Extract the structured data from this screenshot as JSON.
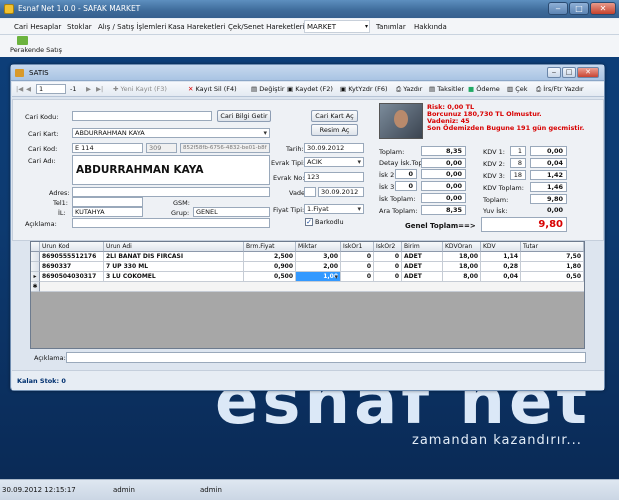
{
  "app_title": "Esnaf Net 1.0.0 - SAFAK MARKET",
  "menu": [
    "Cari Hesaplar",
    "Stoklar",
    "Alış / Satış İşlemleri",
    "Kasa Hareketleri",
    "Çek/Senet Hareketleri",
    "MARKET",
    "Tanımlar",
    "Hakkında"
  ],
  "quick_button": "Perakende Satış",
  "satis": {
    "title": "SATIS",
    "nav_position": "1",
    "nav_total": "-1",
    "toolbar": {
      "yeni": "Yeni Kayıt (F3)",
      "sil": "Kayıt Sil (F4)",
      "degistir": "Değiştir",
      "kaydet": "Kaydet (F2)",
      "kytyzdr": "KytYzdr (F6)",
      "yazdir": "Yazdır",
      "taksitler": "Taksitler",
      "odeme": "Ödeme",
      "cek": "Çek",
      "irs": "İrs/Ftr Yazdır"
    },
    "form": {
      "cari_kodu_label": "Cari Kodu:",
      "cari_bilgi_btn": "Cari Bilgi Getir",
      "cari_kart_label": "Cari Kart:",
      "cari_kart_value": "ABDURRAHMAN KAYA",
      "cari_kod_label": "Cari Kod:",
      "cari_kod_value": "E 114",
      "cari_no": "309",
      "cari_guid": "852f58fb-6756-4832-be01-b8f",
      "cari_adi_label": "Cari Adı:",
      "cari_adi_value": "ABDURRAHMAN KAYA",
      "adres_label": "Adres:",
      "tel_label": "Tel1:",
      "gsm_label": "GSM:",
      "il_label": "İL:",
      "il_value": "KUTAHYA",
      "grup_label": "Grup:",
      "grup_value": "GENEL",
      "aciklama_label": "Açıklama:",
      "cari_kart_ac_btn": "Cari Kart Aç",
      "resim_ac_btn": "Resim Aç",
      "tarih_label": "Tarih:",
      "tarih_value": "30.09.2012",
      "evrak_tipi_label": "Evrak Tipi:",
      "evrak_tipi_value": "ACIK",
      "evrak_no_label": "Evrak No:",
      "evrak_no_value": "123",
      "vade_label": "Vade:",
      "vade_value": "30.09.2012",
      "fiyat_tipi_label": "Fiyat Tipi:",
      "fiyat_tipi_value": "1.Fiyat",
      "barkodlu_label": "Barkodlu"
    },
    "alerts": [
      "Risk: 0,00 TL",
      "Borcunuz 180,730 TL Olmustur.",
      "Vadeniz: 45",
      "Son Ödemizden Bugune 191 gün gecmistir."
    ],
    "totals": {
      "toplam_label": "Toplam:",
      "toplam": "8,35",
      "detay_isk_label": "Detay İsk.Top:",
      "detay_isk": "0,00",
      "isk2_label": "İsk 2:",
      "isk2_pct": "0",
      "isk2": "0,00",
      "isk3_label": "İsk 3:",
      "isk3_pct": "0",
      "isk3": "0,00",
      "isk_toplam_label": "İsk Toplam:",
      "isk_toplam": "0,00",
      "ara_toplam_label": "Ara Toplam:",
      "ara_toplam": "8,35",
      "genel_label": "Genel Toplam==>",
      "genel": "9,80"
    },
    "kdv": {
      "kdv1_label": "KDV 1:",
      "kdv1_rate": "1",
      "kdv1": "0,00",
      "kdv2_label": "KDV 2:",
      "kdv2_rate": "8",
      "kdv2": "0,04",
      "kdv3_label": "KDV 3:",
      "kdv3_rate": "18",
      "kdv3": "1,42",
      "kdv_toplam_label": "KDV Toplam:",
      "kdv_toplam": "1,46",
      "toplam_label": "Toplam:",
      "toplam": "9,80",
      "yuv_isk_label": "Yuv İsk:",
      "yuv_isk": "0,00"
    },
    "grid": {
      "headers": [
        "Urun Kod",
        "Urun Adi",
        "Brm.Fiyat",
        "Miktar",
        "IskOr1",
        "IskOr2",
        "Birim",
        "KDVOran",
        "KDV",
        "Tutar"
      ],
      "rows": [
        [
          "8690555512176",
          "2LI BANAT DIS FIRCASI",
          "2,500",
          "3,00",
          "0",
          "0",
          "ADET",
          "18,00",
          "1,14",
          "7,50"
        ],
        [
          "8690337",
          "7 UP 330 ML",
          "0,900",
          "2,00",
          "0",
          "0",
          "ADET",
          "18,00",
          "0,28",
          "1,80"
        ],
        [
          "8690504030317",
          "3 LU COKOMEL",
          "0,500",
          "1,00",
          "0",
          "0",
          "ADET",
          "8,00",
          "0,04",
          "0,50"
        ]
      ]
    },
    "aciklama_bottom_label": "Açıklama:",
    "kalan_stok_label": "Kalan Stok:",
    "kalan_stok_value": "0"
  },
  "logo_main": "esnaf net",
  "logo_sub": "zamandan kazandırır...",
  "status": {
    "datetime": "30.09.2012 12:15:17",
    "user1": "admin",
    "user2": "admin"
  }
}
